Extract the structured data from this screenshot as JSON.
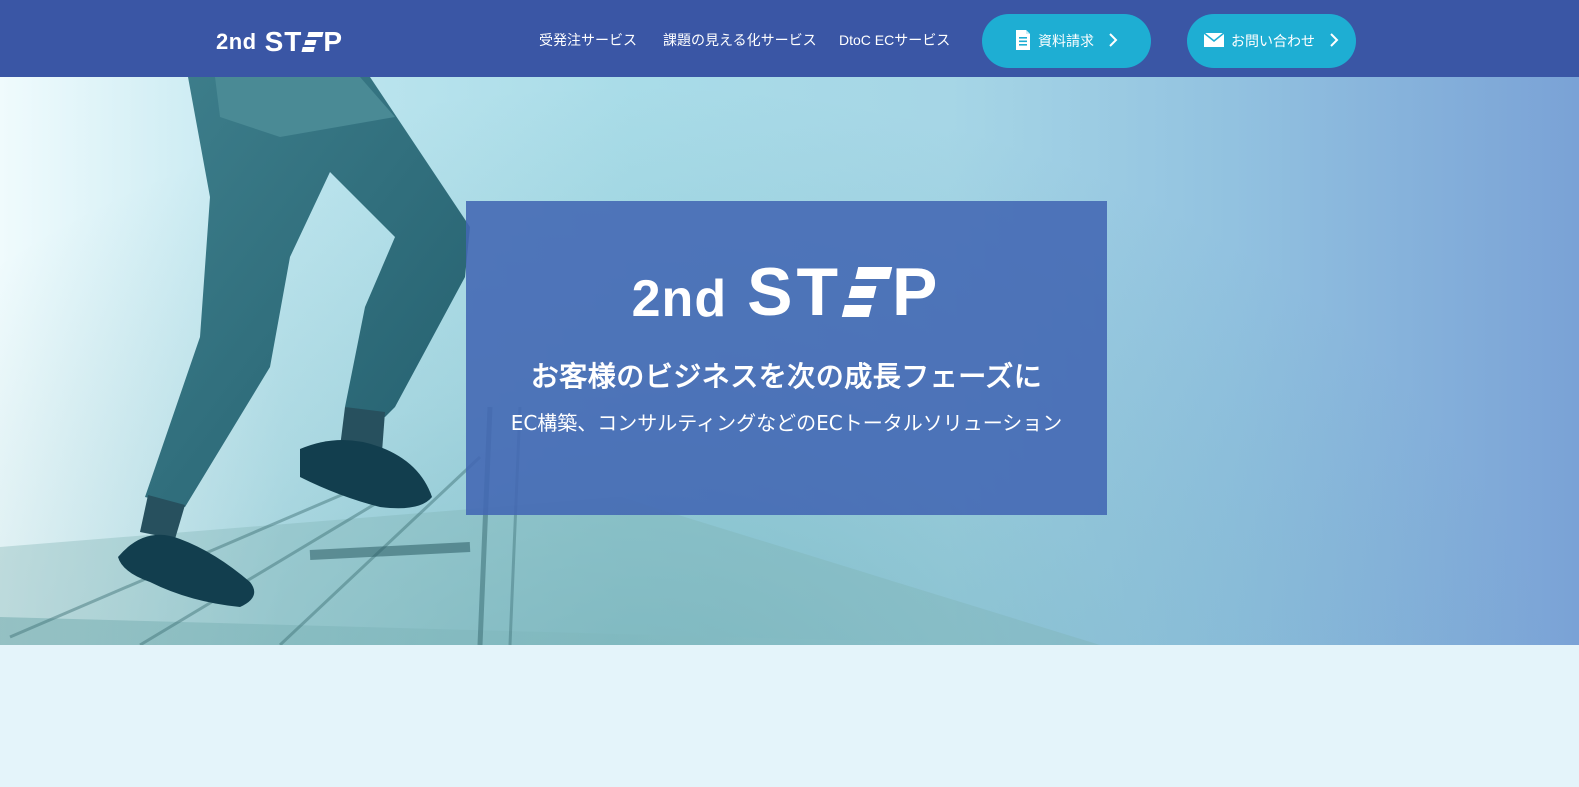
{
  "header": {
    "logo": {
      "prefix": "2nd",
      "word_start": "ST",
      "word_end": "P"
    },
    "nav": [
      {
        "label": "受発注サービス"
      },
      {
        "label": "課題の見える化サービス"
      },
      {
        "label": "DtoC ECサービス"
      }
    ],
    "cta": [
      {
        "label": "資料請求",
        "icon": "document-icon"
      },
      {
        "label": "お問い合わせ",
        "icon": "mail-icon"
      }
    ]
  },
  "hero": {
    "logo": {
      "prefix": "2nd",
      "word_start": "ST",
      "word_end": "P"
    },
    "tagline": "お客様のビジネスを次の成長フェーズに",
    "subtitle": "EC構築、コンサルティングなどのECトータルソリューション"
  },
  "colors": {
    "header_bg": "#3a56a5",
    "cta_bg": "#1eaed3",
    "hero_box": "#4267b3",
    "page_bg": "#e4f4fa"
  }
}
